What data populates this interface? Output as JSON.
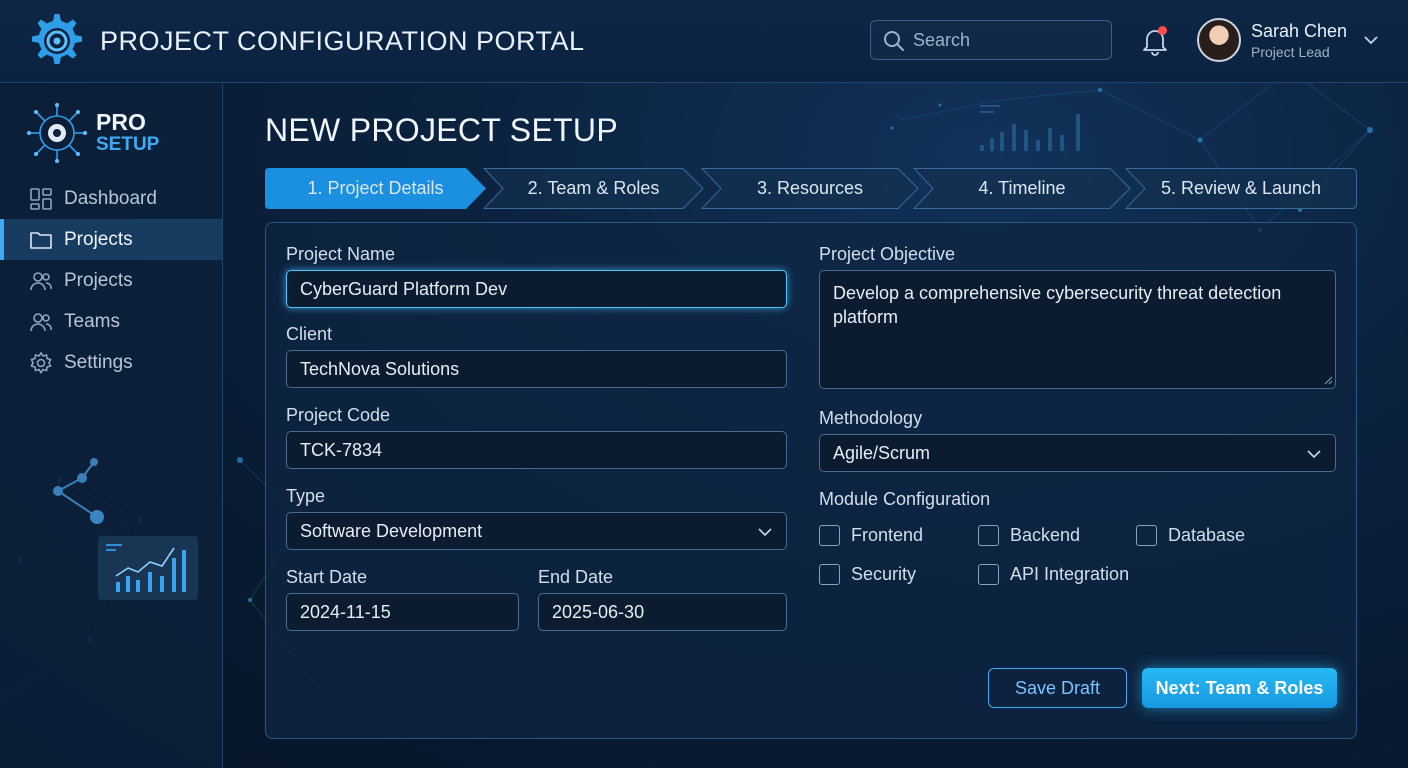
{
  "header": {
    "title": "PROJECT CONFIGURATION PORTAL",
    "search_placeholder": "Search",
    "user": {
      "name": "Sarah Chen",
      "role": "Project Lead"
    }
  },
  "sidebar": {
    "brand_line1": "PRO",
    "brand_line2": "SETUP",
    "items": [
      {
        "label": "Dashboard",
        "icon": "dashboard-icon",
        "active": false
      },
      {
        "label": "Projects",
        "icon": "folder-icon",
        "active": true
      },
      {
        "label": "Projects",
        "icon": "users-icon",
        "active": false
      },
      {
        "label": "Teams",
        "icon": "users-icon",
        "active": false
      },
      {
        "label": "Settings",
        "icon": "gear-icon",
        "active": false
      }
    ]
  },
  "main": {
    "title": "NEW PROJECT SETUP",
    "steps": [
      {
        "label": "1. Project Details",
        "active": true
      },
      {
        "label": "2. Team & Roles",
        "active": false
      },
      {
        "label": "3. Resources",
        "active": false
      },
      {
        "label": "4. Timeline",
        "active": false
      },
      {
        "label": "5. Review & Launch",
        "active": false
      }
    ],
    "form": {
      "project_name_label": "Project Name",
      "project_name_value": "CyberGuard Platform Dev",
      "client_label": "Client",
      "client_value": "TechNova Solutions",
      "project_code_label": "Project Code",
      "project_code_value": "TCK-7834",
      "type_label": "Type",
      "type_value": "Software Development",
      "start_date_label": "Start Date",
      "start_date_value": "2024-11-15",
      "end_date_label": "End Date",
      "end_date_value": "2025-06-30",
      "objective_label": "Project Objective",
      "objective_value": "Develop a comprehensive cybersecurity threat detection platform",
      "methodology_label": "Methodology",
      "methodology_value": "Agile/Scrum",
      "modules_label": "Module Configuration",
      "modules": [
        {
          "label": "Frontend",
          "checked": false
        },
        {
          "label": "Backend",
          "checked": false
        },
        {
          "label": "Database",
          "checked": false
        },
        {
          "label": "Security",
          "checked": false
        },
        {
          "label": "API Integration",
          "checked": false
        }
      ]
    },
    "buttons": {
      "save_draft": "Save Draft",
      "next": "Next: Team & Roles"
    }
  },
  "colors": {
    "accent": "#3fa9f5",
    "active_step": "#1b8fe0",
    "primary_button": "#27b9f5",
    "background": "#0b2340"
  }
}
